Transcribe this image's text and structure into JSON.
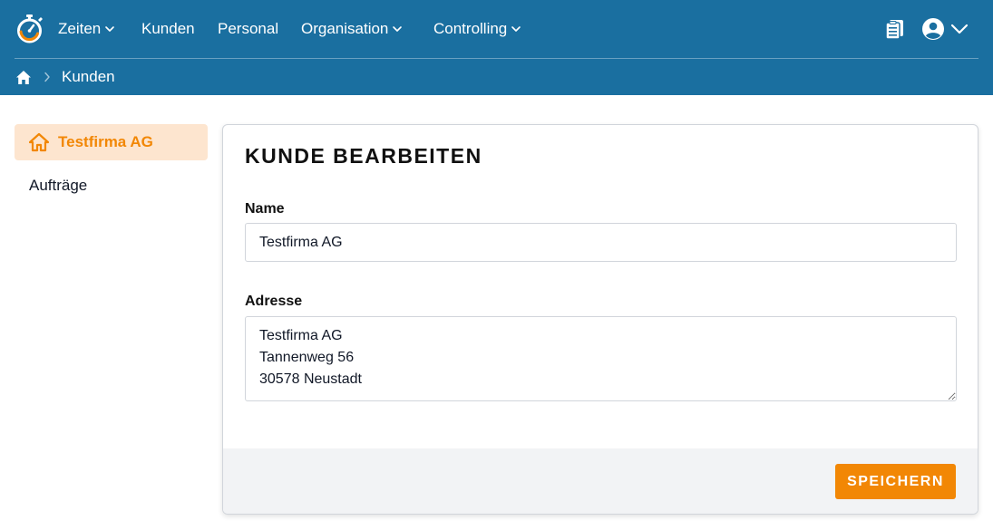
{
  "colors": {
    "header": "#1a6fa0",
    "accent": "#f28705",
    "accent_light": "#fde5cf",
    "footer": "#f2f3f5"
  },
  "nav": {
    "items": [
      {
        "label": "Zeiten",
        "dropdown": true
      },
      {
        "label": "Kunden",
        "dropdown": false
      },
      {
        "label": "Personal",
        "dropdown": false
      },
      {
        "label": "Organisation",
        "dropdown": true
      },
      {
        "label": "Controlling",
        "dropdown": true
      }
    ],
    "icons": [
      "stopwatch-logo-icon",
      "clipboard-icon",
      "user-circle-icon",
      "chevron-down-icon"
    ]
  },
  "breadcrumb": {
    "home_icon": "home-icon",
    "items": [
      "Kunden"
    ]
  },
  "sidebar": {
    "items": [
      {
        "label": "Testfirma AG",
        "active": true,
        "icon": "house-icon"
      },
      {
        "label": "Aufträge",
        "active": false
      }
    ]
  },
  "form": {
    "title": "KUNDE BEARBEITEN",
    "name_label": "Name",
    "name_value": "Testfirma AG",
    "address_label": "Adresse",
    "address_value": "Testfirma AG\nTannenweg 56\n30578 Neustadt",
    "save_label": "SPEICHERN"
  }
}
